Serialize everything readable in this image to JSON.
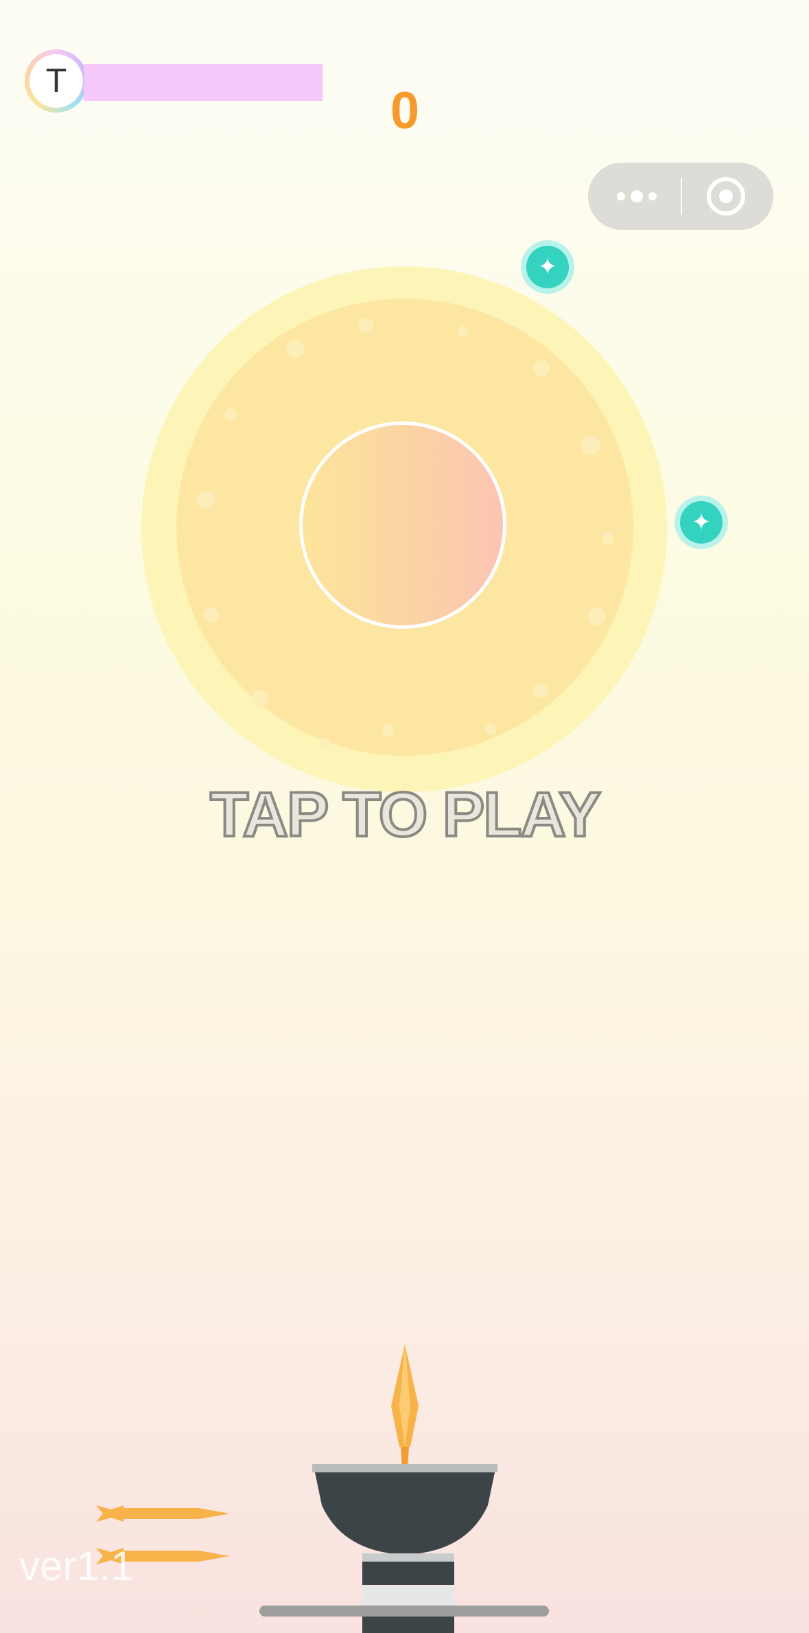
{
  "player": {
    "avatar_letter": "T"
  },
  "hud": {
    "score": "0"
  },
  "capsule": {
    "more_icon": "more-dots-icon",
    "close_icon": "target-close-icon"
  },
  "game": {
    "prompt": "TAP TO PLAY",
    "gems": [
      "gem-icon",
      "gem-icon"
    ],
    "remaining_darts": 2
  },
  "footer": {
    "version": "ver1.1"
  },
  "colors": {
    "score": "#f79a2d",
    "progress": "#f5c8f9",
    "wheel_outer": "#fdf5b8",
    "wheel_inner": "#fde6a1",
    "gem": "#33d3c0",
    "launcher": "#3d4447",
    "dart": "#f7b24a"
  }
}
